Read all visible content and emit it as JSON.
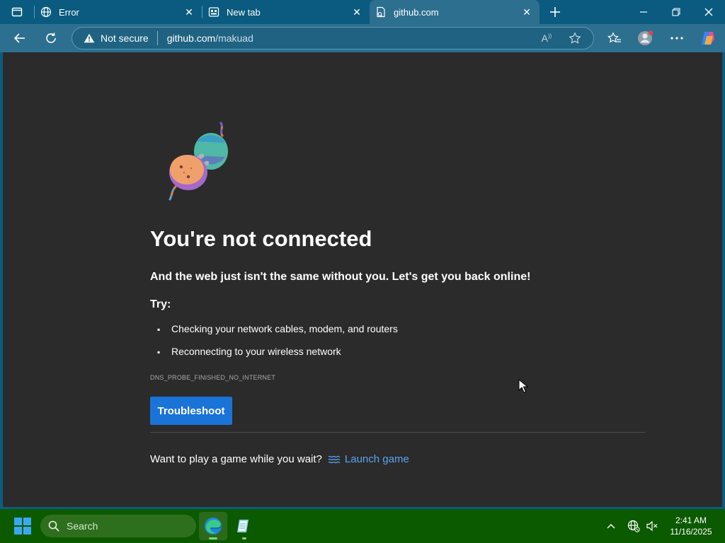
{
  "browser": {
    "tabs": [
      {
        "title": "Error",
        "icon": "globe-icon",
        "active": false
      },
      {
        "title": "New tab",
        "icon": "newtab-icon",
        "active": false
      },
      {
        "title": "github.com",
        "icon": "page-offline-icon",
        "active": true
      }
    ],
    "address": {
      "security_label": "Not secure",
      "url_host": "github.com",
      "url_path": "/makuad"
    }
  },
  "page": {
    "title": "You're not connected",
    "subtitle": "And the web just isn't the same without you. Let's get you back online!",
    "try_label": "Try:",
    "tips": [
      "Checking your network cables, modem, and routers",
      "Reconnecting to your wireless network"
    ],
    "error_code": "DNS_PROBE_FINISHED_NO_INTERNET",
    "troubleshoot_label": "Troubleshoot",
    "game_prompt": "Want to play a game while you wait?",
    "launch_game_label": "Launch game"
  },
  "taskbar": {
    "search_placeholder": "Search",
    "time": "2:41 AM",
    "date": "11/16/2025"
  },
  "colors": {
    "titlebar": "#0a5b7f",
    "toolbar": "#2d6f8f",
    "page_bg": "#2b2b2b",
    "accent_button": "#1a73d6",
    "link": "#5aa4f2",
    "taskbar": "#0b5a00"
  }
}
